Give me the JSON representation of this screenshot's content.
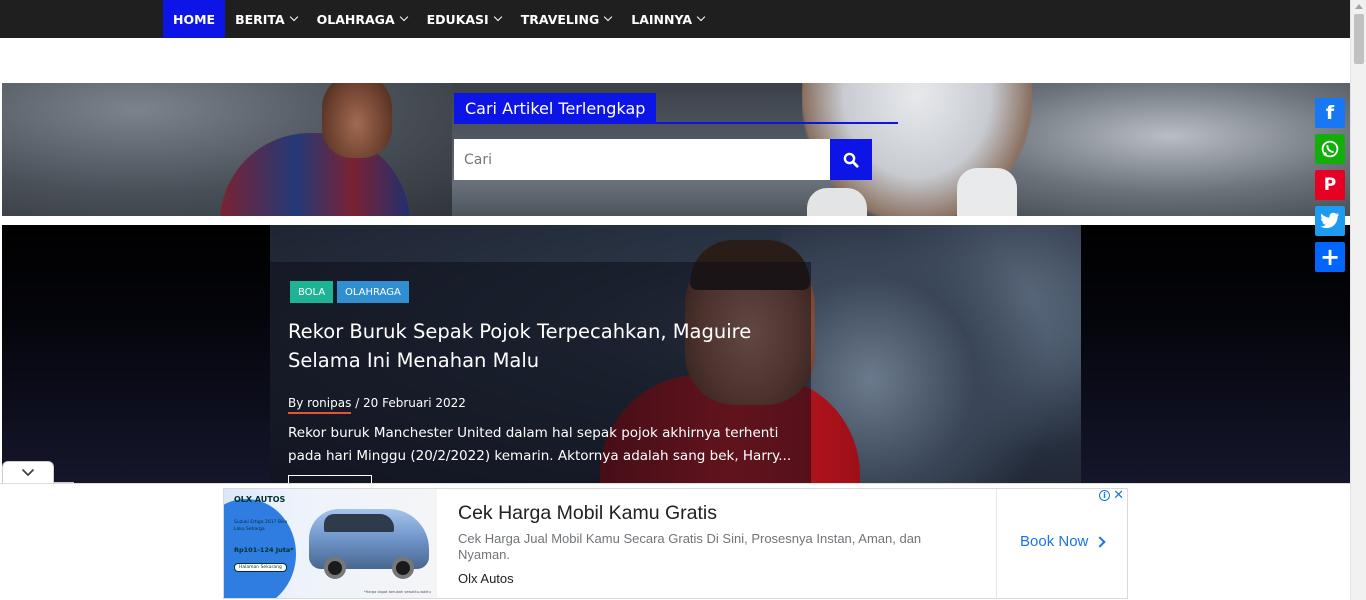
{
  "nav": {
    "items": [
      {
        "label": "HOME",
        "active": true,
        "dropdown": false
      },
      {
        "label": "BERITA",
        "active": false,
        "dropdown": true
      },
      {
        "label": "OLAHRAGA",
        "active": false,
        "dropdown": true
      },
      {
        "label": "EDUKASI",
        "active": false,
        "dropdown": true
      },
      {
        "label": "TRAVELING",
        "active": false,
        "dropdown": true
      },
      {
        "label": "LAINNYA",
        "active": false,
        "dropdown": true
      }
    ]
  },
  "search": {
    "title": "Cari Artikel Terlengkap",
    "placeholder": "Cari",
    "button_icon": "search-icon"
  },
  "featured": {
    "tags": [
      "BOLA",
      "OLAHRAGA"
    ],
    "title": "Rekor Buruk Sepak Pojok Terpecahkan, Maguire Selama Ini Menahan Malu",
    "by": "By",
    "author": "ronipas",
    "date": "/ 20 Februari 2022",
    "excerpt": "Rekor buruk Manchester United dalam hal sepak pojok akhirnya terhenti pada hari Minggu (20/2/2022) kemarin. Aktornya adalah sang bek, Harry..."
  },
  "social": [
    "facebook-icon",
    "whatsapp-icon",
    "pinterest-icon",
    "twitter-icon",
    "share-icon"
  ],
  "ad": {
    "image": {
      "brand": "OLX AUTOS",
      "text": "Suzuki Ertiga 2017 Bisa Laku Seharga",
      "price": "Rp101-124 Juta*",
      "cta": "Halaman Sekarang",
      "footnote": "*Harga dapat berubah sewaktu-waktu"
    },
    "title": "Cek Harga Mobil Kamu Gratis",
    "description": "Cek Harga Jual Mobil Kamu Secara Gratis Di Sini, Prosesnya Instan, Aman, dan Nyaman.",
    "advertiser": "Olx Autos",
    "button": "Book Now"
  },
  "colors": {
    "nav_bg": "#1f1f1f",
    "accent": "#0d15e6",
    "tag_bola": "#1fb396",
    "tag_olahraga": "#2f8fd1",
    "author_underline": "#e5533d",
    "facebook": "#1877f2",
    "whatsapp": "#12af0a",
    "pinterest": "#e60023",
    "twitter": "#1d9bf0",
    "share": "#0166ff",
    "ad_link": "#1a73e8"
  }
}
